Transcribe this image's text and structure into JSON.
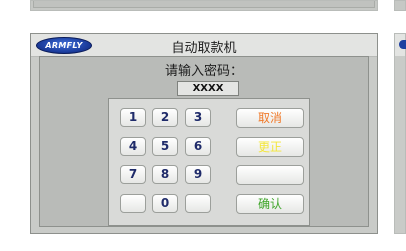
{
  "window": {
    "logo_text": "ARMFLY",
    "title": "自动取款机"
  },
  "prompt": "请输入密码：",
  "password_value": "XXXX",
  "keypad": {
    "digits": [
      "1",
      "2",
      "3",
      "4",
      "5",
      "6",
      "7",
      "8",
      "9",
      "",
      "0",
      ""
    ],
    "cancel_label": "取消",
    "cancel_color": "#f07a2a",
    "correct_label": "更正",
    "correct_color": "#f3e63a",
    "blank_label": "",
    "confirm_label": "确认",
    "confirm_color": "#3fa52a"
  }
}
